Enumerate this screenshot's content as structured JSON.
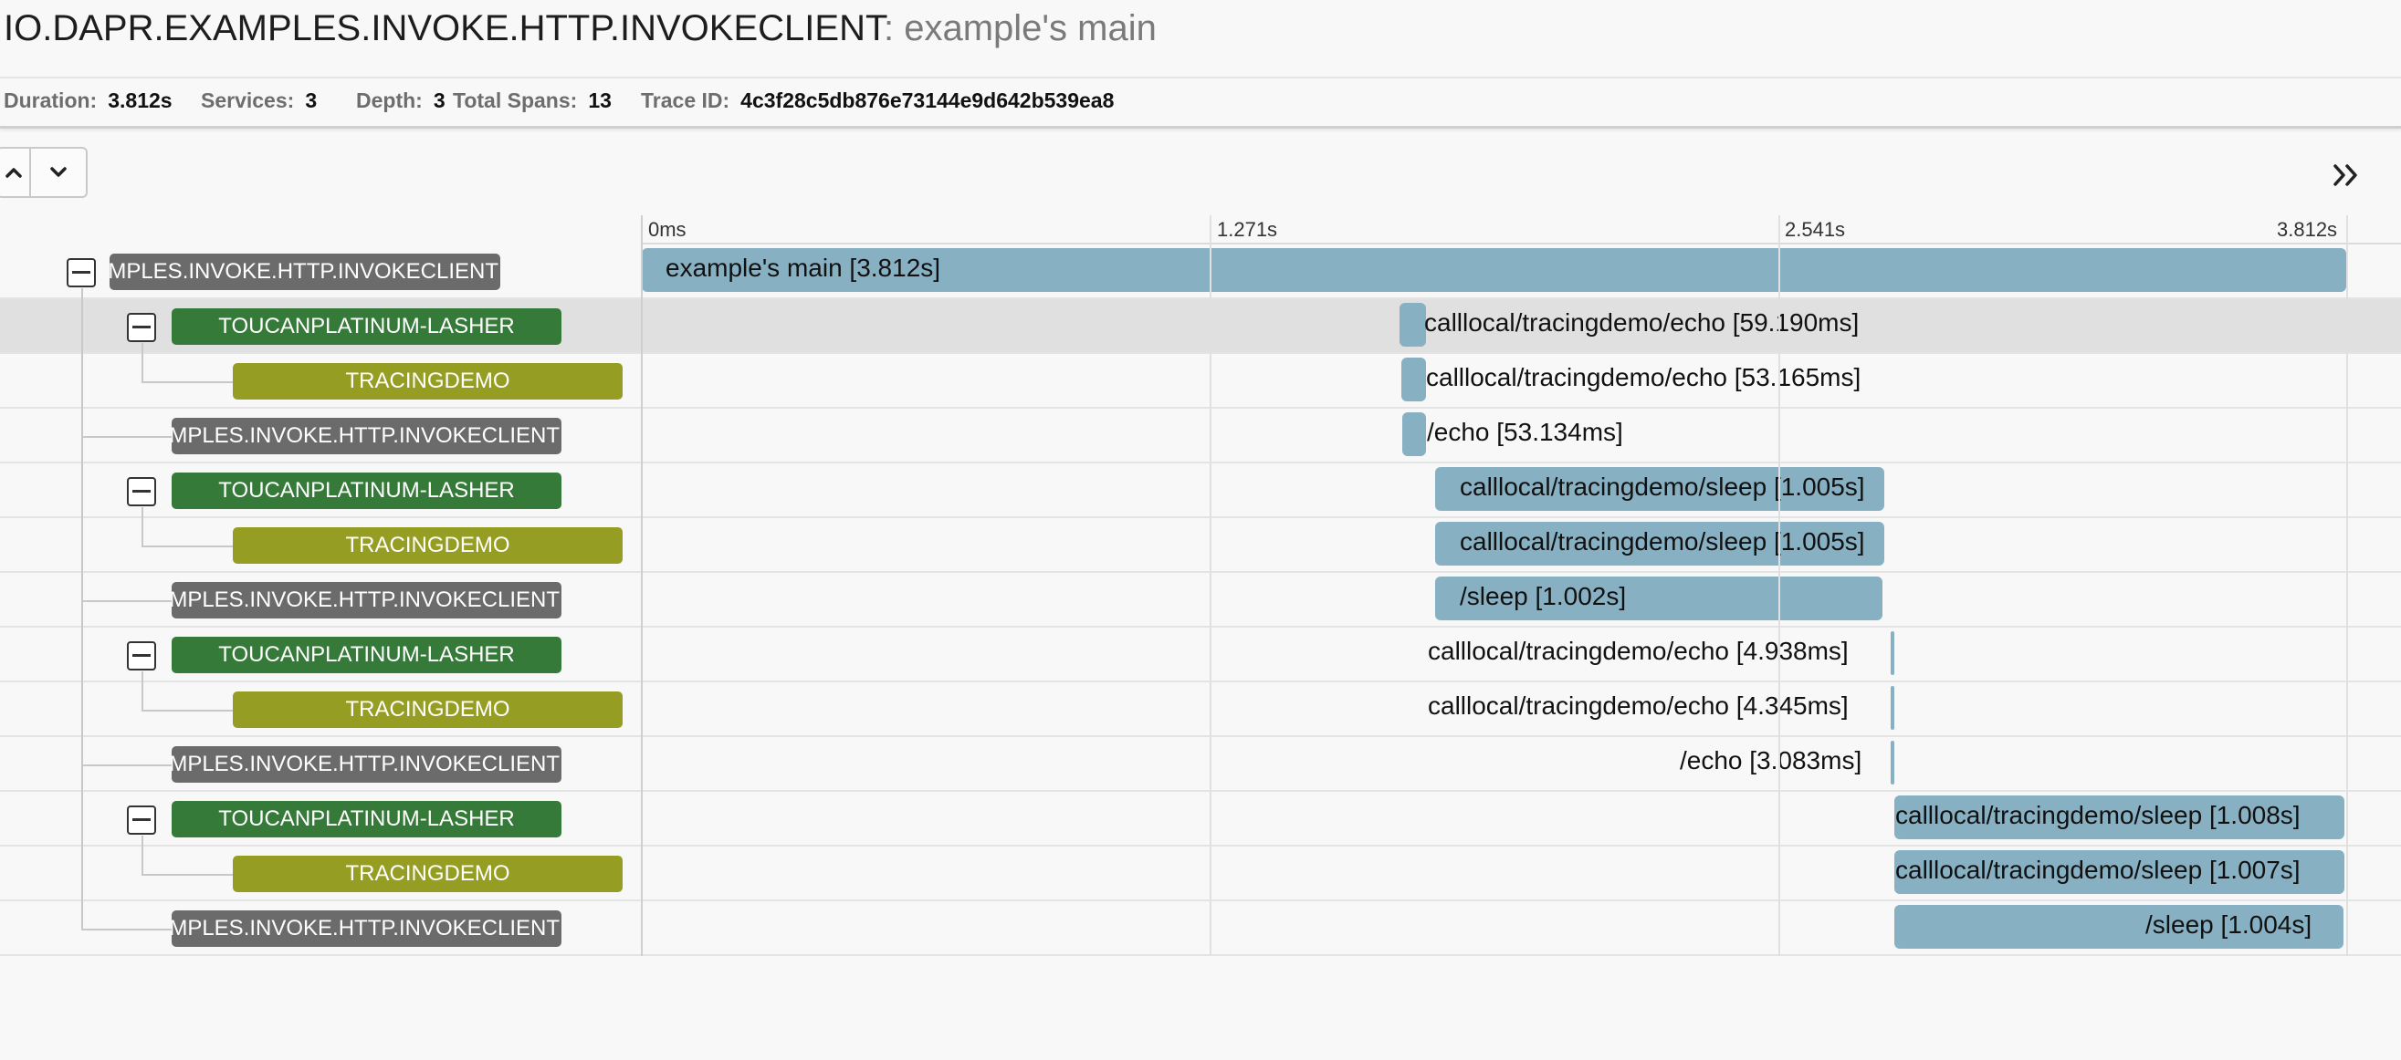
{
  "header": {
    "service": "IO.DAPR.EXAMPLES.INVOKE.HTTP.INVOKECLIENT",
    "operation": ": example's main"
  },
  "meta": {
    "duration_label": "Duration:",
    "duration_value": "3.812s",
    "services_label": "Services:",
    "services_value": "3",
    "depth_label": "Depth:",
    "depth_value": "3",
    "spans_label": "Total Spans:",
    "spans_value": "13",
    "trace_label": "Trace ID:",
    "trace_value": "4c3f28c5db876e73144e9d642b539ea8"
  },
  "icons": {
    "up": "chevron-up-icon",
    "down": "chevron-down-icon",
    "expand": "double-chevron-right-icon",
    "collapse": "collapse-toggle-icon"
  },
  "colors": {
    "span_bar": "#88b0c3",
    "invokeclient": "#6b6b6b",
    "toucanplatinum": "#357a38",
    "tracingdemo": "#969d23",
    "selected_row": "#e0e0e0"
  },
  "timeline": {
    "ticks": [
      "0ms",
      "1.271s",
      "2.541s",
      "3.812s"
    ]
  },
  "spans": [
    {
      "service": "IO.DAPR.EXAMPLES.INVOKE.HTTP.INVOKECLIENT",
      "label": "example's main [3.812s]",
      "selected": false,
      "collapsible": true
    },
    {
      "service": "TOUCANPLATINUM-LASHER",
      "label": "calllocal/tracingdemo/echo [59.190ms]",
      "selected": true,
      "collapsible": true
    },
    {
      "service": "TRACINGDEMO",
      "label": "calllocal/tracingdemo/echo [53.165ms]",
      "selected": false,
      "collapsible": false
    },
    {
      "service": "IO.DAPR.EXAMPLES.INVOKE.HTTP.INVOKECLIENT",
      "label": "/echo [53.134ms]",
      "selected": false,
      "collapsible": false
    },
    {
      "service": "TOUCANPLATINUM-LASHER",
      "label": "calllocal/tracingdemo/sleep [1.005s]",
      "selected": false,
      "collapsible": true
    },
    {
      "service": "TRACINGDEMO",
      "label": "calllocal/tracingdemo/sleep [1.005s]",
      "selected": false,
      "collapsible": false
    },
    {
      "service": "IO.DAPR.EXAMPLES.INVOKE.HTTP.INVOKECLIENT",
      "label": "/sleep [1.002s]",
      "selected": false,
      "collapsible": false
    },
    {
      "service": "TOUCANPLATINUM-LASHER",
      "label": "calllocal/tracingdemo/echo [4.938ms]",
      "selected": false,
      "collapsible": true
    },
    {
      "service": "TRACINGDEMO",
      "label": "calllocal/tracingdemo/echo [4.345ms]",
      "selected": false,
      "collapsible": false
    },
    {
      "service": "IO.DAPR.EXAMPLES.INVOKE.HTTP.INVOKECLIENT",
      "label": "/echo [3.083ms]",
      "selected": false,
      "collapsible": false
    },
    {
      "service": "TOUCANPLATINUM-LASHER",
      "label": "calllocal/tracingdemo/sleep [1.008s]",
      "selected": false,
      "collapsible": true
    },
    {
      "service": "TRACINGDEMO",
      "label": "calllocal/tracingdemo/sleep [1.007s]",
      "selected": false,
      "collapsible": false
    },
    {
      "service": "IO.DAPR.EXAMPLES.INVOKE.HTTP.INVOKECLIENT",
      "label": "/sleep [1.004s]",
      "selected": false,
      "collapsible": false
    }
  ]
}
